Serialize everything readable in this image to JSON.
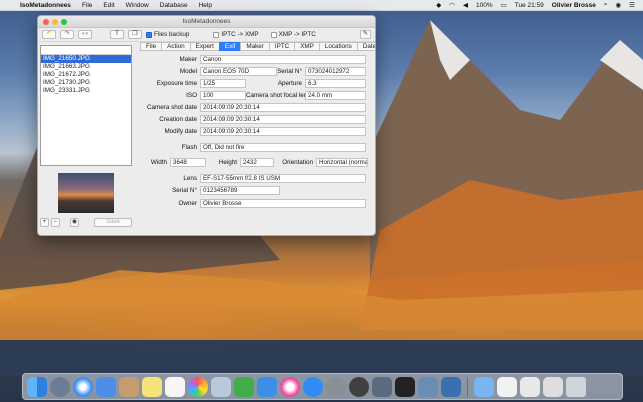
{
  "menubar": {
    "app_name": "IsoMetadonnees",
    "items": [
      "File",
      "Edit",
      "Window",
      "Database",
      "Help"
    ],
    "battery": "100%",
    "clock": "Tue 21:59",
    "user": "Olivier Brosse"
  },
  "window": {
    "title": "IsoMetadonnees",
    "toolbar": {
      "files_backup_label": "Files backup",
      "files_backup_checked": true,
      "iptc_to_xmp_label": "IPTC -> XMP",
      "xmp_to_iptc_label": "XMP -> IPTC"
    },
    "files": [
      {
        "name": "IMG_21650.JPG",
        "selected": true
      },
      {
        "name": "IMG_21663.JPG",
        "selected": false
      },
      {
        "name": "IMG_21672.JPG",
        "selected": false
      },
      {
        "name": "IMG_21730.JPG",
        "selected": false
      },
      {
        "name": "IMG_23331.JPG",
        "selected": false
      }
    ],
    "left_footer": {
      "add": "+",
      "remove": "−",
      "save_label": "Save"
    },
    "tabs": [
      {
        "label": "File",
        "active": false
      },
      {
        "label": "Action",
        "active": false
      },
      {
        "label": "Expert",
        "active": false
      },
      {
        "label": "Exif",
        "active": true
      },
      {
        "label": "Maker",
        "active": false
      },
      {
        "label": "IPTC",
        "active": false
      },
      {
        "label": "XMP",
        "active": false
      },
      {
        "label": "Locations",
        "active": false
      },
      {
        "label": "Dates",
        "active": false
      }
    ],
    "exif": {
      "maker_label": "Maker",
      "maker": "Canon",
      "model_label": "Model",
      "model": "Canon EOS 70D",
      "serial_label": "Serial N°",
      "serial": "073024012972",
      "exposure_label": "Exposure time",
      "exposure": "1/25",
      "aperture_label": "Aperture",
      "aperture": "6.3",
      "iso_label": "ISO",
      "iso": "100",
      "focal_label": "Camera shot focal ler",
      "focal": "24.0 mm",
      "shot_date_label": "Camera shot date",
      "shot_date": "2014:09:09 20:30:14",
      "creation_label": "Creation date",
      "creation": "2014:09:09 20:30:14",
      "modify_label": "Modify date",
      "modify": "2014:09:09 20:30:14",
      "flash_label": "Flash",
      "flash": "Off, Did not fire",
      "width_label": "Width",
      "width": "3648",
      "height_label": "Height",
      "height": "2432",
      "orientation_label": "Orientation",
      "orientation": "Horizontal (normal",
      "lens_label": "Lens",
      "lens": "EF-S17-55mm f/2.8 IS USM",
      "lens_serial_label": "Serial N°",
      "lens_serial": "0123456789",
      "owner_label": "Owner",
      "owner": "Olivier Brosse"
    }
  },
  "colors": {
    "accent": "#2e7cf6",
    "selection": "#2e6bd7"
  },
  "dock": {
    "icons": [
      "finder-icon",
      "launchpad-icon",
      "safari-icon",
      "mail-icon",
      "contacts-icon",
      "notes-icon",
      "reminders-icon",
      "photos-icon",
      "preview-icon",
      "numbers-icon",
      "keynote-icon",
      "itunes-icon",
      "app-store-icon",
      "system-preferences-icon",
      "isometadonnees-icon",
      "image-capture-icon",
      "terminal-icon",
      "photo-app-icon",
      "screenshot-icon",
      "folder-icon",
      "document-icon",
      "document-icon-2",
      "trash-icon"
    ]
  }
}
